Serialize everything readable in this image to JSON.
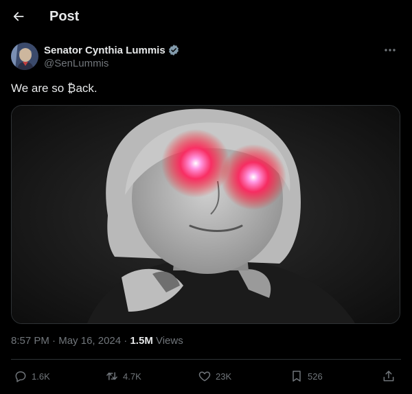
{
  "header": {
    "title": "Post"
  },
  "author": {
    "display_name": "Senator Cynthia Lummis",
    "handle": "@SenLummis"
  },
  "tweet": {
    "text": "We are so ₿ack."
  },
  "meta": {
    "time": "8:57 PM",
    "separator1": " · ",
    "date": "May 16, 2024",
    "separator2": " · ",
    "views_count": "1.5M",
    "views_label": " Views"
  },
  "actions": {
    "replies": "1.6K",
    "reposts": "4.7K",
    "likes": "23K",
    "bookmarks": "526"
  },
  "colors": {
    "background": "#000000",
    "text": "#e7e9ea",
    "secondary": "#71767b",
    "verified": "#829aab",
    "border": "#2f3336"
  }
}
